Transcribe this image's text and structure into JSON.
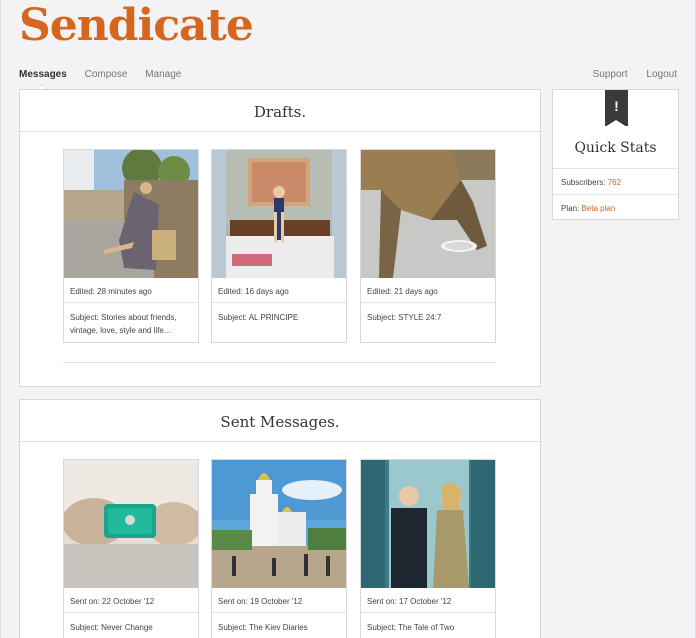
{
  "app": {
    "logo": "Sendicate"
  },
  "nav": {
    "left": [
      "Messages",
      "Compose",
      "Manage"
    ],
    "right": [
      "Support",
      "Logout"
    ]
  },
  "drafts": {
    "title": "Drafts.",
    "cards": [
      {
        "meta": "Edited: 28 minutes ago",
        "subject": "Subject: Stories about friends, vintage, love, style and life..."
      },
      {
        "meta": "Edited: 16 days ago",
        "subject": "Subject: AL PRINCIPE"
      },
      {
        "meta": "Edited: 21 days ago",
        "subject": "Subject: STYLE 24:7"
      }
    ]
  },
  "sent": {
    "title": "Sent Messages.",
    "cards": [
      {
        "meta": "Sent on: 22 October '12",
        "subject": "Subject: Never Change"
      },
      {
        "meta": "Sent on: 19 October '12",
        "subject": "Subject: The Kiev Diaries"
      },
      {
        "meta": "Sent on: 17 October '12",
        "subject": "Subject: The Tale of Two"
      }
    ]
  },
  "quick_stats": {
    "badge": "!",
    "title": "Quick Stats",
    "subscribers_label": "Subscribers:",
    "subscribers_value": "762",
    "plan_label": "Plan:",
    "plan_value": "Beta plan"
  },
  "colors": {
    "brand": "#d4661e",
    "background": "#f3f3f6"
  }
}
